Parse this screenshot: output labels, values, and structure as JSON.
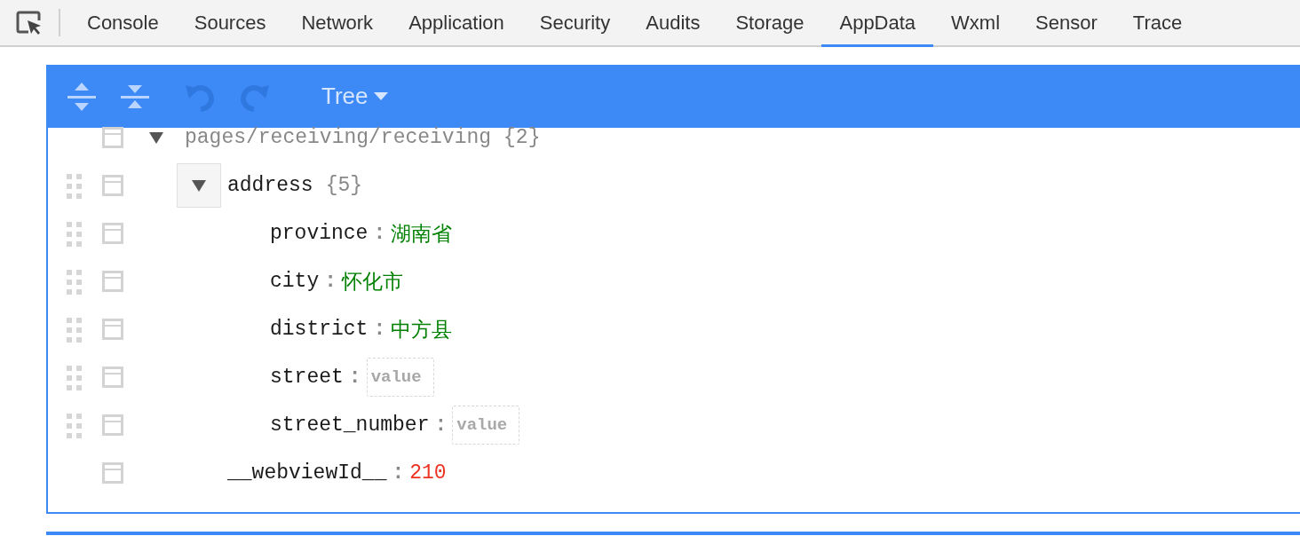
{
  "tabs": [
    {
      "label": "Console",
      "selected": false
    },
    {
      "label": "Sources",
      "selected": false
    },
    {
      "label": "Network",
      "selected": false
    },
    {
      "label": "Application",
      "selected": false
    },
    {
      "label": "Security",
      "selected": false
    },
    {
      "label": "Audits",
      "selected": false
    },
    {
      "label": "Storage",
      "selected": false
    },
    {
      "label": "AppData",
      "selected": true
    },
    {
      "label": "Wxml",
      "selected": false
    },
    {
      "label": "Sensor",
      "selected": false
    },
    {
      "label": "Trace",
      "selected": false
    }
  ],
  "toolbar": {
    "undo": {
      "disabled": true
    },
    "redo": {
      "disabled": true
    },
    "mode_menu": {
      "label": "Tree"
    }
  },
  "tree": {
    "key": "pages/receiving/receiving",
    "kind": "object",
    "count": "{2}",
    "expanded": true,
    "draggable": false,
    "focused": false,
    "children": [
      {
        "key": "address",
        "kind": "object",
        "count": "{5}",
        "expanded": true,
        "draggable": true,
        "focused": true,
        "children": [
          {
            "key": "province",
            "separator": ":",
            "kind": "string",
            "value": "湖南省",
            "draggable": true
          },
          {
            "key": "city",
            "separator": ":",
            "kind": "string",
            "value": "怀化市",
            "draggable": true
          },
          {
            "key": "district",
            "separator": ":",
            "kind": "string",
            "value": "中方县",
            "draggable": true
          },
          {
            "key": "street",
            "separator": ":",
            "kind": "empty",
            "placeholder": "value",
            "draggable": true
          },
          {
            "key": "street_number",
            "separator": ":",
            "kind": "empty",
            "placeholder": "value",
            "draggable": true
          }
        ]
      },
      {
        "key": "__webviewId__",
        "separator": ":",
        "kind": "number",
        "value": "210",
        "draggable": false
      }
    ]
  }
}
